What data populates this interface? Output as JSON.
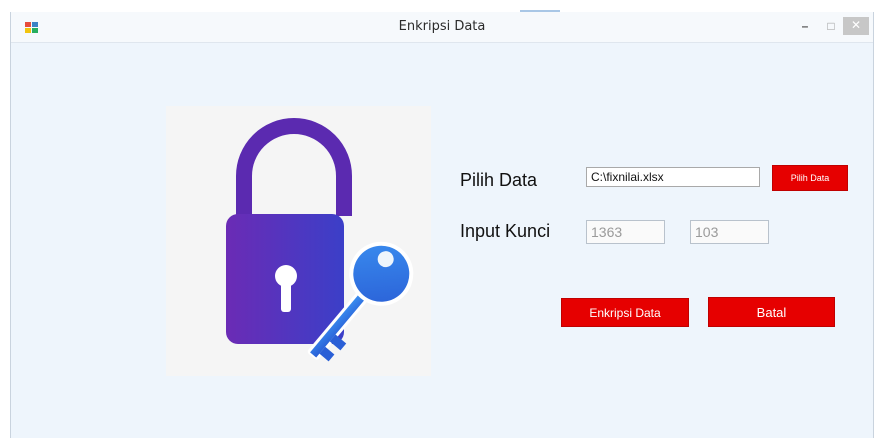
{
  "window": {
    "title": "Enkripsi Data",
    "controls": {
      "minimize": "–",
      "maximize": "□",
      "close": "✕"
    }
  },
  "form": {
    "pilih_label": "Pilih Data",
    "file_path": "C:\\fixnilai.xlsx",
    "pilih_button": "Pilih Data",
    "kunci_label": "Input Kunci",
    "kunci_1": "1363",
    "kunci_2": "103",
    "encrypt_button": "Enkripsi Data",
    "cancel_button": "Batal"
  },
  "colors": {
    "accent_button": "#e60000",
    "form_background": "#eef5fc",
    "lock_purple": "#5b2ab0",
    "key_blue": "#2f6fe0"
  },
  "icons": {
    "app": "app-icon",
    "lock": "padlock-with-key-icon"
  }
}
